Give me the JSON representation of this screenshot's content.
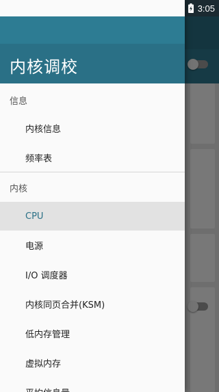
{
  "status_bar": {
    "time": "3:05"
  },
  "drawer": {
    "title": "内核调校",
    "sections": [
      {
        "label": "信息",
        "items": [
          "内核信息",
          "频率表"
        ]
      },
      {
        "label": "内核",
        "items": [
          "CPU",
          "电源",
          "I/O 调度器",
          "内核同页合并(KSM)",
          "低内存管理",
          "虚拟内存",
          "平均信息量"
        ]
      }
    ],
    "active_item": "CPU"
  },
  "colors": {
    "primary": "#2a7086",
    "active_bg": "#e2e2e2",
    "status_bar": "#1b2a31"
  }
}
